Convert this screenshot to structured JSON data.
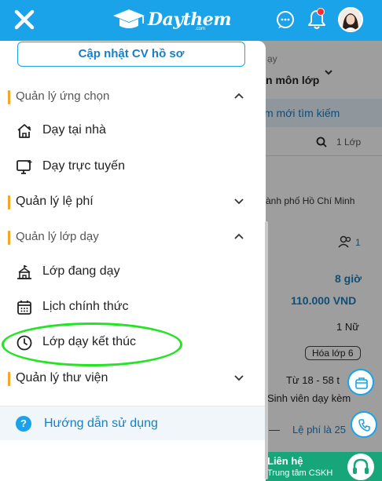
{
  "header": {
    "brand": "Daythem",
    "brand_sub": ".com",
    "icons": [
      "close-icon",
      "chat-icon",
      "bell-icon",
      "avatar"
    ],
    "notification_dot_color": "#ff2d2d",
    "bar_color": "#1aa3e8"
  },
  "drawer": {
    "cv_button": "Cập nhật CV hồ sơ",
    "sections": [
      {
        "title": "Quản lý ứng chọn",
        "expanded": true,
        "items": [
          {
            "label": "Dạy tại nhà",
            "icon": "home-icon"
          },
          {
            "label": "Dạy trực tuyến",
            "icon": "monitor-icon"
          }
        ]
      },
      {
        "title": "Quản lý lệ phí",
        "expanded": false,
        "items": []
      },
      {
        "title": "Quản lý lớp dạy",
        "expanded": true,
        "items": [
          {
            "label": "Lớp đang dạy",
            "icon": "classroom-icon"
          },
          {
            "label": "Lịch chính thức",
            "icon": "calendar-icon"
          },
          {
            "label": "Lớp dạy kết thúc",
            "icon": "clock-icon"
          }
        ]
      },
      {
        "title": "Quản lý thư viện",
        "expanded": false,
        "items": []
      }
    ],
    "help": "Hướng dẫn sử dụng",
    "accent_color": "#f5a623"
  },
  "background": {
    "t1": "ạy",
    "t2": "n môn lớp",
    "t3": "m mới tìm kiếm",
    "t4": "1 Lớp",
    "t5": "ành phố Hồ Chí Minh",
    "t6": "1",
    "t7": "8 giờ",
    "t8": "110.000 VND",
    "t9": "1 Nữ",
    "t10": "Hóa lớp 6",
    "t11": "Từ 18 - 58 t",
    "t12": "Sinh viên dạy kèm",
    "t13": "Lệ phí là 25",
    "t14": "Liên hệ",
    "t15": "Trung tâm CSKH"
  }
}
